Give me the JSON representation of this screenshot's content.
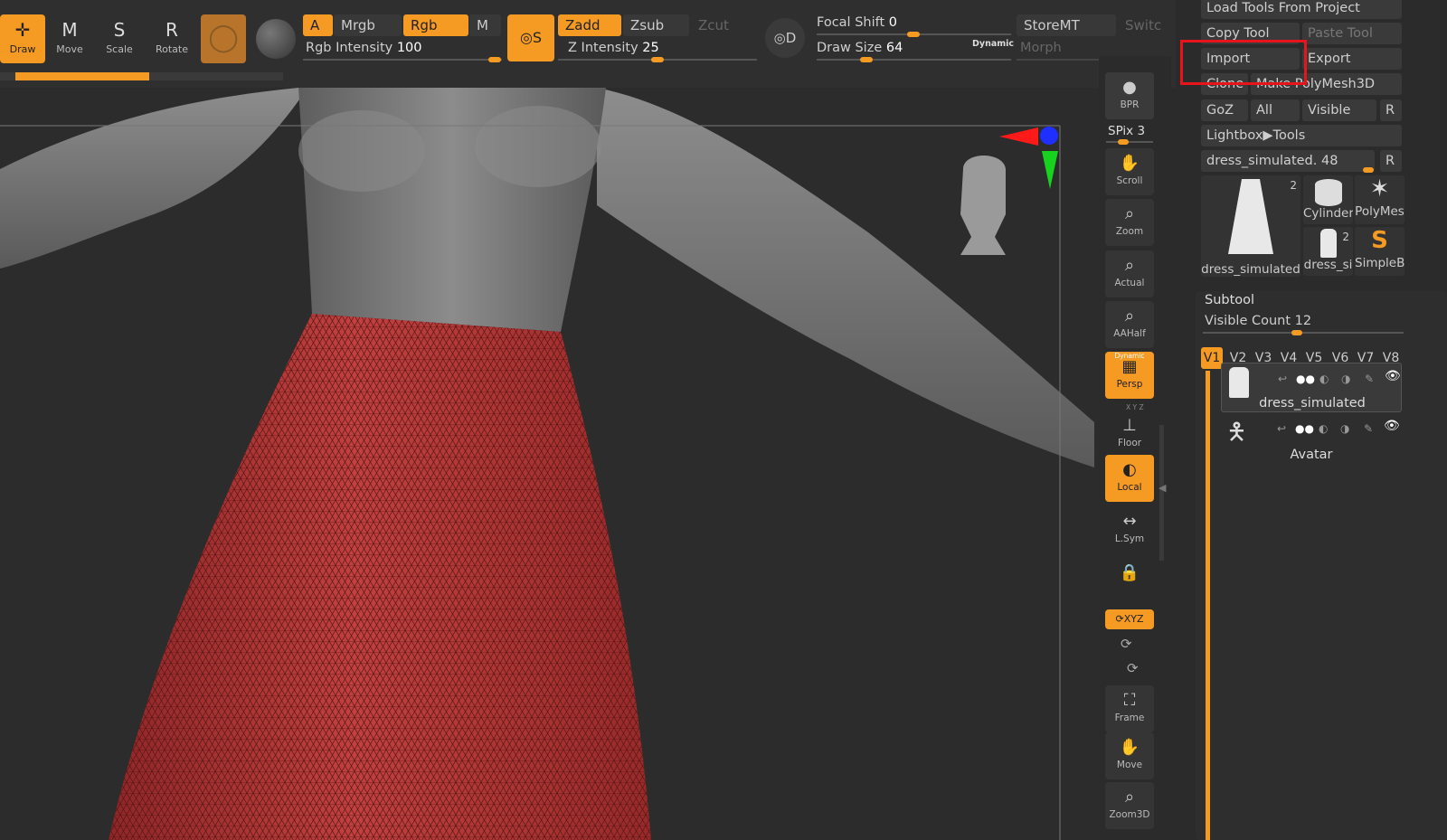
{
  "toolbar": {
    "draw": "Draw",
    "move": "Move",
    "scale": "Scale",
    "rotate": "Rotate",
    "draw_glyph": "M",
    "move_glyph": "M",
    "scale_glyph": "S",
    "rotate_glyph": "R",
    "a_label": "A",
    "mrgb": "Mrgb",
    "rgb": "Rgb",
    "m": "M",
    "rgb_intensity_label": "Rgb Intensity",
    "rgb_intensity_value": "100",
    "s_label": "S",
    "zadd": "Zadd",
    "zsub": "Zsub",
    "zcut": "Zcut",
    "z_intensity_label": "Z Intensity",
    "z_intensity_value": "25",
    "d_label": "D",
    "focal_shift_label": "Focal Shift",
    "focal_shift_value": "0",
    "draw_size_label": "Draw Size",
    "draw_size_value": "64",
    "dynamic": "Dynamic",
    "storemt": "StoreMT",
    "switch": "Switc",
    "morph": "Morph"
  },
  "shelf": {
    "bpr": "BPR",
    "spix_label": "SPix",
    "spix_value": "3",
    "scroll": "Scroll",
    "zoom": "Zoom",
    "actual": "Actual",
    "aahalf": "AAHalf",
    "persp": "Persp",
    "persp_top": "Dynamic",
    "floor": "Floor",
    "floor_top": "X Y Z",
    "local": "Local",
    "lsym": "L.Sym",
    "xyz": "XYZ",
    "frame": "Frame",
    "move": "Move",
    "zoom3d": "Zoom3D"
  },
  "tool_panel": {
    "load_tools": "Load Tools From Project",
    "copy_tool": "Copy Tool",
    "paste_tool": "Paste Tool",
    "import": "Import",
    "export": "Export",
    "clone": "Clone",
    "make_polymesh": "Make PolyMesh3D",
    "goz": "GoZ",
    "all": "All",
    "visible": "Visible",
    "r": "R",
    "lightbox_tools": "Lightbox▶Tools",
    "current_tool_label": "dress_simulated.",
    "current_tool_value": "48",
    "r2": "R",
    "thumbs": [
      {
        "label": "dress_simulated",
        "count": "2"
      },
      {
        "label": "Cylinder"
      },
      {
        "label": "PolyMes"
      },
      {
        "label": "dress_si",
        "count": "2"
      },
      {
        "label": "SimpleB"
      }
    ]
  },
  "subtool": {
    "title": "Subtool",
    "visible_count_label": "Visible Count",
    "visible_count_value": "12",
    "versions": [
      "V1",
      "V2",
      "V3",
      "V4",
      "V5",
      "V6",
      "V7",
      "V8"
    ],
    "items": [
      {
        "name": "dress_simulated"
      },
      {
        "name": "Avatar"
      }
    ]
  },
  "colors": {
    "accent": "#f59a23",
    "highlight": "#e8141b",
    "dress": "#b8393a"
  }
}
